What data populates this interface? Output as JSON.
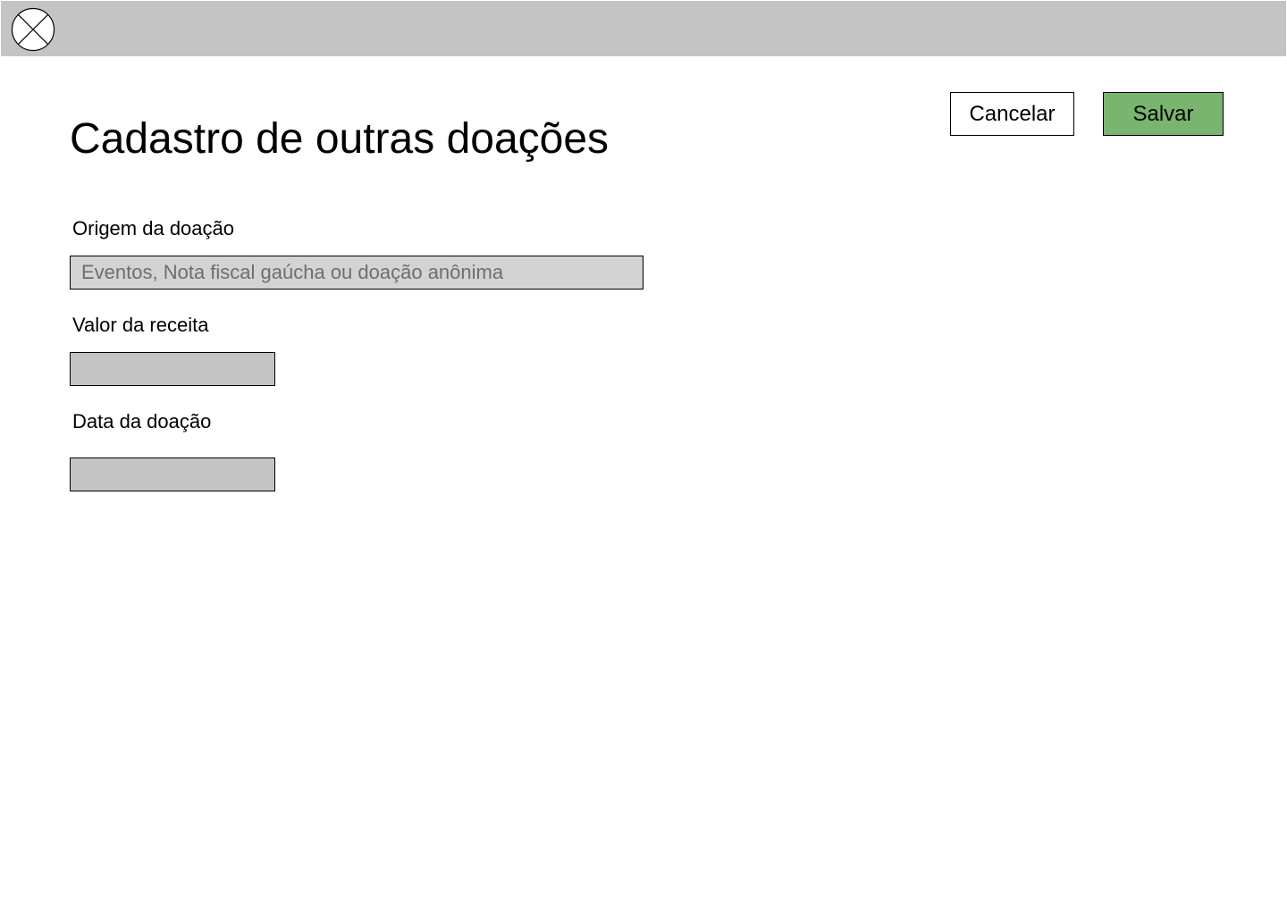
{
  "header": {
    "logo_icon": "logo-placeholder-icon",
    "background": "#c4c4c4"
  },
  "page": {
    "title": "Cadastro de outras doações"
  },
  "actions": {
    "cancel_label": "Cancelar",
    "save_label": "Salvar",
    "save_color": "#7ab56f"
  },
  "form": {
    "origin": {
      "label": "Origem da doação",
      "value": "",
      "placeholder": "Eventos, Nota fiscal gaúcha ou doação anônima"
    },
    "value": {
      "label": "Valor da receita",
      "value": "",
      "placeholder": ""
    },
    "date": {
      "label": "Data da doação",
      "value": "",
      "placeholder": ""
    }
  }
}
